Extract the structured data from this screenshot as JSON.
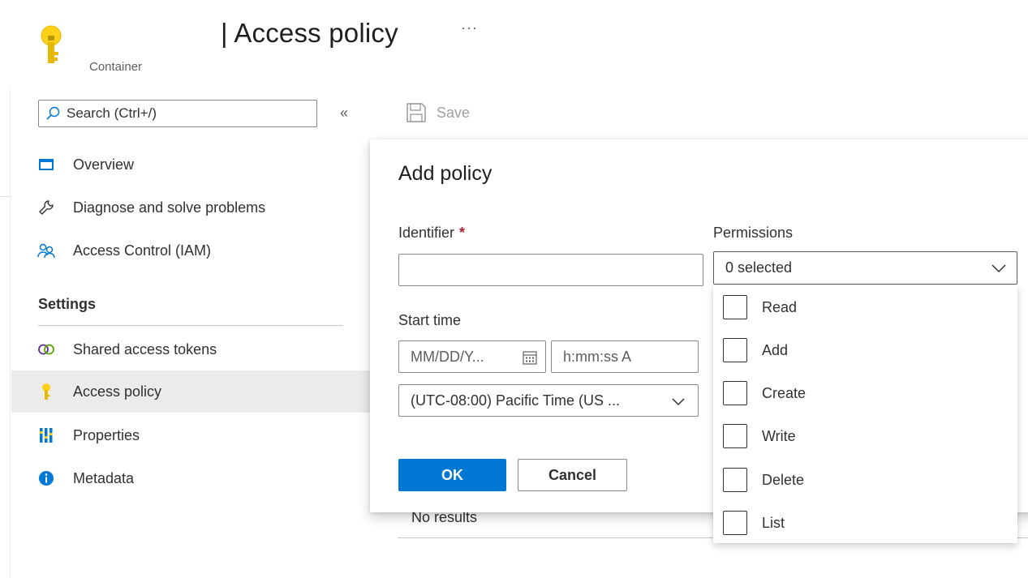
{
  "header": {
    "title": "| Access policy",
    "more": "···",
    "resource_type": "Container",
    "resource_icon": "key-icon"
  },
  "sidebar": {
    "search_placeholder": "Search (Ctrl+/)",
    "collapse": "«",
    "items": [
      {
        "label": "Overview",
        "icon": "overview-icon"
      },
      {
        "label": "Diagnose and solve problems",
        "icon": "wrench-icon"
      },
      {
        "label": "Access Control (IAM)",
        "icon": "people-icon"
      }
    ],
    "settings_header": "Settings",
    "settings_items": [
      {
        "label": "Shared access tokens",
        "icon": "link-icon"
      },
      {
        "label": "Access policy",
        "icon": "key-icon",
        "active": true
      },
      {
        "label": "Properties",
        "icon": "properties-icon"
      },
      {
        "label": "Metadata",
        "icon": "info-icon"
      }
    ]
  },
  "toolbar": {
    "save_label": "Save"
  },
  "main": {
    "empty_text": "No results"
  },
  "panel": {
    "title": "Add policy",
    "identifier_label": "Identifier",
    "required_marker": "*",
    "identifier_value": "",
    "permissions_label": "Permissions",
    "permissions_value": "0 selected",
    "start_time_label": "Start time",
    "date_placeholder": "MM/DD/Y...",
    "time_placeholder": "h:mm:ss A",
    "timezone_value": "(UTC-08:00) Pacific Time (US ...",
    "ok_label": "OK",
    "cancel_label": "Cancel",
    "permission_options": [
      "Read",
      "Add",
      "Create",
      "Write",
      "Delete",
      "List"
    ]
  },
  "colors": {
    "accent": "#0078d4",
    "key_yellow": "#fcd116",
    "active_bg": "#edebe9"
  }
}
